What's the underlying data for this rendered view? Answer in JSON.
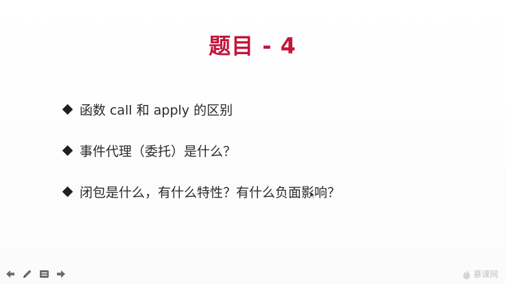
{
  "slide": {
    "title": "题目 - 4",
    "items": [
      "函数 call 和 apply 的区别",
      "事件代理（委托）是什么？",
      "闭包是什么，有什么特性？有什么负面影响？"
    ]
  },
  "toolbar": {
    "icons": [
      "arrow-left-icon",
      "pen-icon",
      "menu-icon",
      "arrow-right-icon"
    ]
  },
  "watermark": {
    "text": "慕课网"
  },
  "colors": {
    "title": "#c3163b",
    "text": "#2a2a2a",
    "toolbar_icon": "#6b6b6b",
    "watermark": "#c2c2c2"
  }
}
